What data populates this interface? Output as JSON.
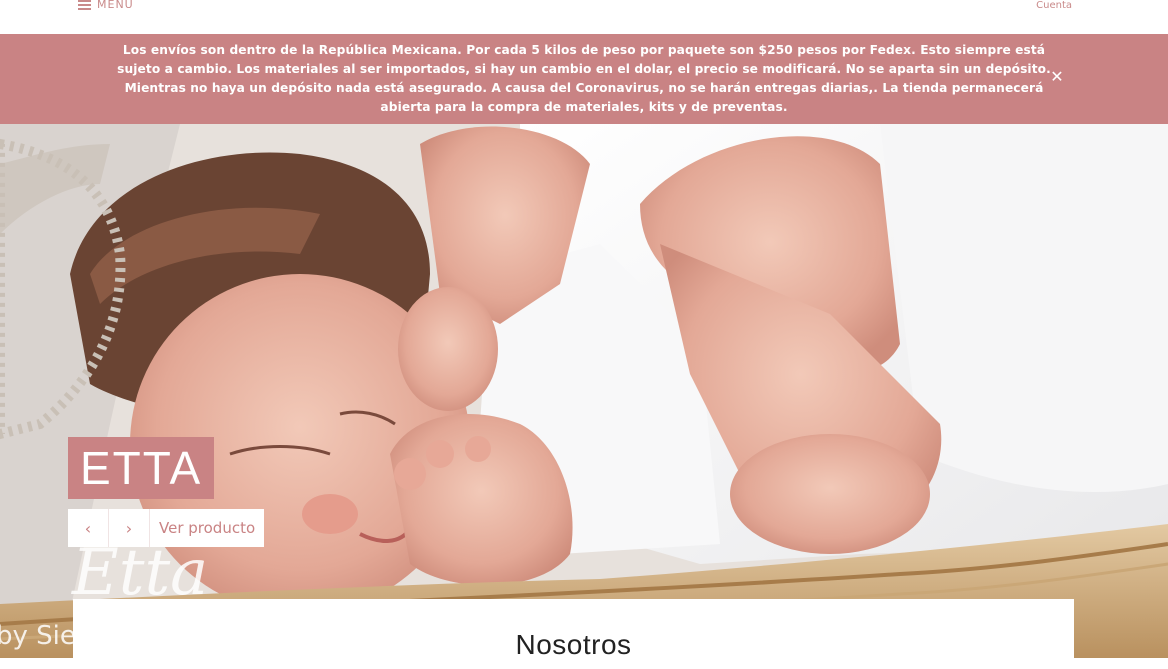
{
  "header": {
    "menu_label": "MENU",
    "account_label": "Cuenta"
  },
  "announcement": {
    "text": "Los envíos son dentro de la República Mexicana. Por cada 5 kilos de peso por paquete son $250 pesos por Fedex. Esto siempre está sujeto a cambio. Los materiales al ser importados, si hay un cambio en el dolar, el precio se modificará. No se aparta sin un depósito. Mientras no haya un depósito nada está asegurado. A causa del Coronavirus, no se harán entregas diarias,. La tienda permanecerá abierta para la compra de materiales, kits y de preventas.",
    "close_icon": "close-icon"
  },
  "hero": {
    "slide_title": "ETTA",
    "prev_icon": "‹",
    "next_icon": "›",
    "view_label": "Ver producto",
    "image_script_text": "Etta",
    "image_caption_fragment": "by Sie"
  },
  "about": {
    "title": "Nosotros"
  },
  "colors": {
    "accent": "#c98384",
    "accent_text": "#c98a8a"
  }
}
